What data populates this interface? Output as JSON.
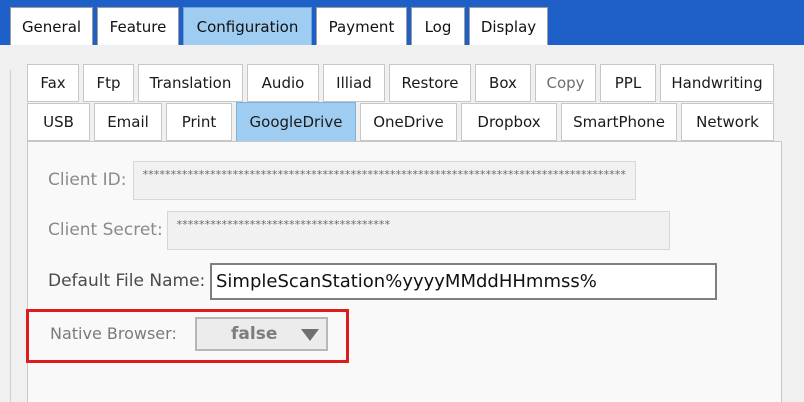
{
  "top_tabs": [
    "General",
    "Feature",
    "Configuration",
    "Payment",
    "Log",
    "Display"
  ],
  "active_top_tab": "Configuration",
  "sub_tabs_row1": [
    "Fax",
    "Ftp",
    "Translation",
    "Audio",
    "Illiad",
    "Restore",
    "Box",
    "Copy",
    "PPL",
    "Handwriting"
  ],
  "sub_tabs_row2": [
    "USB",
    "Email",
    "Print",
    "GoogleDrive",
    "OneDrive",
    "Dropbox",
    "SmartPhone",
    "Network"
  ],
  "active_sub_tab": "GoogleDrive",
  "form": {
    "client_id_label": "Client ID:",
    "client_id_value": "**************************************************************************************",
    "client_secret_label": "Client Secret:",
    "client_secret_value": "**************************************",
    "default_file_name_label": "Default File Name:",
    "default_file_name_value": "SimpleScanStation%yyyyMMddHHmmss%",
    "native_browser_label": "Native Browser:",
    "native_browser_value": "false"
  },
  "colors": {
    "window_background": "#1f5fc8",
    "active_tab": "#9fcdf1",
    "highlight": "#e01b1b"
  }
}
